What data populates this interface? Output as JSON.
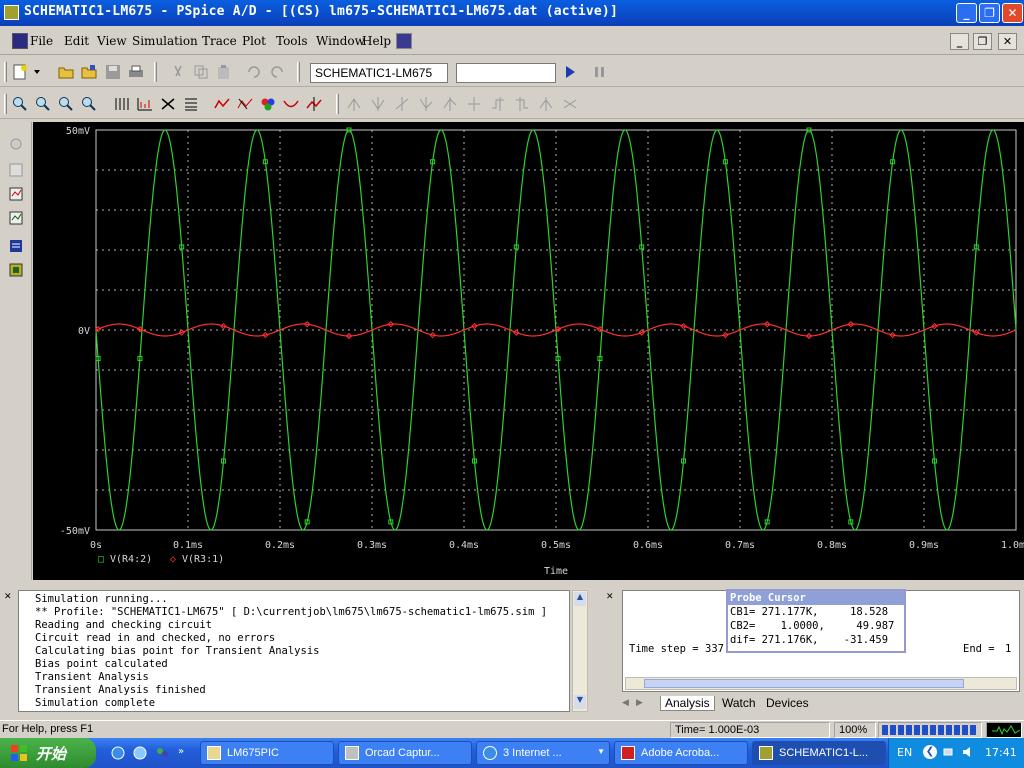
{
  "window": {
    "title": "SCHEMATIC1-LM675 - PSpice A/D  - [(CS) lm675-SCHEMATIC1-LM675.dat (active)]"
  },
  "menu": [
    "File",
    "Edit",
    "View",
    "Simulation",
    "Trace",
    "Plot",
    "Tools",
    "Window",
    "Help"
  ],
  "toolbar": {
    "profile_combo": "SCHEMATIC1-LM675",
    "secondary_combo": ""
  },
  "plot": {
    "background": "#000000",
    "grid_color": "#b0b0b0",
    "trace_colors": [
      "#2ed12e",
      "#ff3030"
    ],
    "y_ticks": [
      "50mV",
      "0V",
      "-50mV"
    ],
    "x_ticks": [
      "0s",
      "0.1ms",
      "0.2ms",
      "0.3ms",
      "0.4ms",
      "0.5ms",
      "0.6ms",
      "0.7ms",
      "0.8ms",
      "0.9ms",
      "1.0ms"
    ],
    "x_label": "Time",
    "legend": [
      {
        "marker": "□",
        "name": "V(R4:2)"
      },
      {
        "marker": "◇",
        "name": "V(R3:1)"
      }
    ]
  },
  "chart_data": {
    "type": "line",
    "xlabel": "Time",
    "ylabel": "",
    "xlim": [
      0,
      0.001
    ],
    "ylim": [
      -0.05,
      0.05
    ],
    "series": [
      {
        "name": "V(R4:2)",
        "kind": "sine",
        "amplitude": 0.05,
        "frequency_hz": 10000,
        "phase_deg": 180
      },
      {
        "name": "V(R3:1)",
        "kind": "sine",
        "amplitude": 0.0015,
        "frequency_hz": 10000,
        "phase_deg": 0
      }
    ]
  },
  "output": {
    "lines": [
      "Simulation running...",
      "** Profile: \"SCHEMATIC1-LM675\"  [ D:\\currentjob\\lm675\\lm675-schematic1-lm675.sim ]",
      "Reading and checking circuit",
      "Circuit read in and checked, no errors",
      "Calculating bias point for Transient Analysis",
      "Bias point calculated",
      "Transient Analysis",
      "Transient Analysis finished",
      "Simulation complete"
    ]
  },
  "sim_status": {
    "time_step_label": "Time step =",
    "time_step_value": "337",
    "end_label": "End =",
    "end_value": "1",
    "tabs": [
      "Analysis",
      "Watch",
      "Devices"
    ]
  },
  "probe_cursor": {
    "title": "Probe Cursor",
    "rows": [
      "CB1= 271.177K,     18.528",
      "CB2=    1.0000,     49.987",
      "dif= 271.176K,    -31.459"
    ]
  },
  "status": {
    "help": "For Help, press F1",
    "time": "Time= 1.000E-03",
    "zoom": "100%"
  },
  "taskbar": {
    "start": "开始",
    "tasks": [
      "LM675PIC",
      "Orcad Captur...",
      "3 Internet ...",
      "Adobe Acroba...",
      "SCHEMATIC1-L..."
    ],
    "lang": "EN",
    "clock": "17:41"
  }
}
